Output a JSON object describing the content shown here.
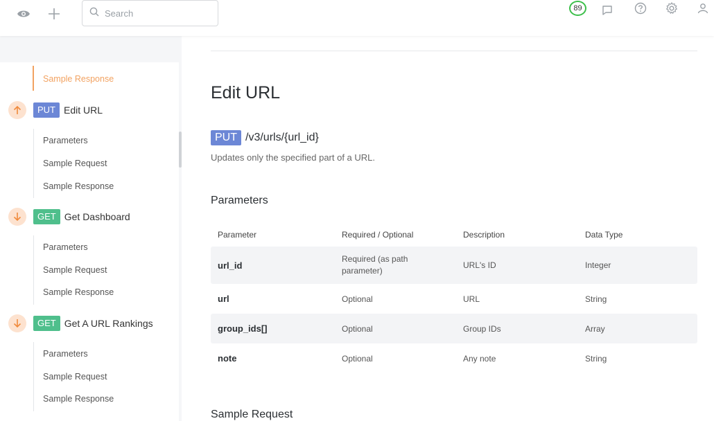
{
  "search": {
    "placeholder": "Search"
  },
  "header": {
    "score": "89"
  },
  "sidebar": {
    "top_active": "Sample Response",
    "endpoints": [
      {
        "direction": "up",
        "method": "PUT",
        "title": "Edit URL",
        "subs": [
          "Parameters",
          "Sample Request",
          "Sample Response"
        ]
      },
      {
        "direction": "down",
        "method": "GET",
        "title": "Get Dashboard",
        "subs": [
          "Parameters",
          "Sample Request",
          "Sample Response"
        ]
      },
      {
        "direction": "down",
        "method": "GET",
        "title": "Get A URL Rankings",
        "subs": [
          "Parameters",
          "Sample Request",
          "Sample Response"
        ]
      }
    ]
  },
  "main": {
    "title": "Edit URL",
    "method": "PUT",
    "path": "/v3/urls/{url_id}",
    "description": "Updates only the specified part of a URL.",
    "parameters_heading": "Parameters",
    "table": {
      "headers": [
        "Parameter",
        "Required / Optional",
        "Description",
        "Data Type"
      ],
      "rows": [
        [
          "url_id",
          "Required (as path parameter)",
          "URL's ID",
          "Integer"
        ],
        [
          "url",
          "Optional",
          "URL",
          "String"
        ],
        [
          "group_ids[]",
          "Optional",
          "Group IDs",
          "Array"
        ],
        [
          "note",
          "Optional",
          "Any note",
          "String"
        ]
      ]
    },
    "sample_request_heading": "Sample Request"
  },
  "colors": {
    "accent_orange": "#f2a261",
    "put_badge": "#6c87d6",
    "get_badge": "#4fbf8c",
    "score_ring": "#3cbf4a"
  }
}
